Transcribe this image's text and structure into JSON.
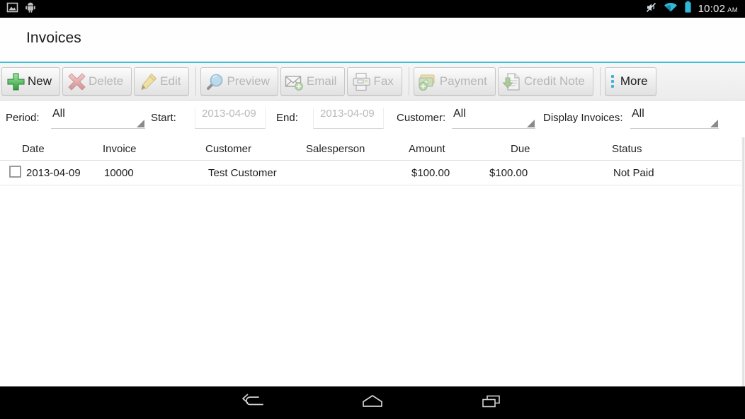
{
  "statusbar": {
    "time": "10:02",
    "ampm": "AM",
    "icons": [
      "gallery-icon",
      "android-icon",
      "mute-icon",
      "wifi-icon",
      "battery-icon"
    ]
  },
  "header": {
    "title": "Invoices",
    "accent_color": "#3fbfd8"
  },
  "toolbar": {
    "buttons": [
      {
        "label": "New",
        "icon": "green-plus-icon",
        "enabled": true
      },
      {
        "label": "Delete",
        "icon": "red-x-icon",
        "enabled": false
      },
      {
        "label": "Edit",
        "icon": "yellow-pencil-icon",
        "enabled": false
      },
      {
        "label": "Preview",
        "icon": "magnifier-icon",
        "enabled": false
      },
      {
        "label": "Email",
        "icon": "envelope-plus-icon",
        "enabled": false
      },
      {
        "label": "Fax",
        "icon": "fax-printer-icon",
        "enabled": false
      },
      {
        "label": "Payment",
        "icon": "money-plus-icon",
        "enabled": false
      },
      {
        "label": "Credit Note",
        "icon": "document-down-icon",
        "enabled": false
      },
      {
        "label": "More",
        "icon": "overflow-dots-icon",
        "enabled": true
      }
    ]
  },
  "filters": {
    "period": {
      "label": "Period:",
      "value": "All"
    },
    "start": {
      "label": "Start:",
      "placeholder": "2013-04-09",
      "value": ""
    },
    "end": {
      "label": "End:",
      "placeholder": "2013-04-09",
      "value": ""
    },
    "customer": {
      "label": "Customer:",
      "value": "All"
    },
    "display": {
      "label": "Display Invoices:",
      "value": "All"
    }
  },
  "table": {
    "columns": [
      "Date",
      "Invoice",
      "Customer",
      "Salesperson",
      "Amount",
      "Due",
      "Status"
    ],
    "rows": [
      {
        "checked": false,
        "date": "2013-04-09",
        "invoice": "10000",
        "customer": "Test Customer",
        "salesperson": "",
        "amount": "$100.00",
        "due": "$100.00",
        "status": "Not Paid"
      }
    ]
  },
  "navbar": {
    "buttons": [
      "back-icon",
      "home-icon",
      "recents-icon"
    ]
  }
}
